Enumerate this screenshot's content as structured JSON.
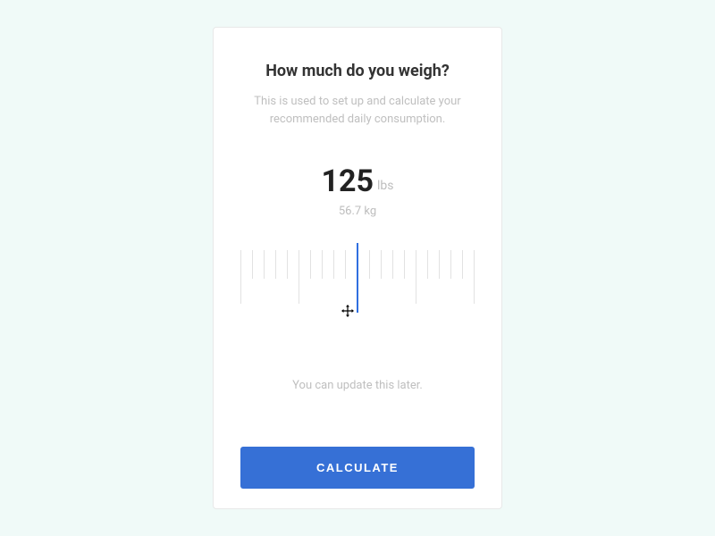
{
  "card": {
    "title": "How much do you weigh?",
    "subtitle": "This is used to set up and calculate your recommended daily consumption.",
    "weight_value": "125",
    "weight_unit": "lbs",
    "weight_alt": "56.7 kg",
    "footnote": "You can update this later.",
    "calculate_label": "CALCULATE"
  },
  "colors": {
    "accent": "#3670d6",
    "background": "#f0faf8",
    "text_primary": "#333333",
    "text_muted": "#bfbfbf"
  }
}
